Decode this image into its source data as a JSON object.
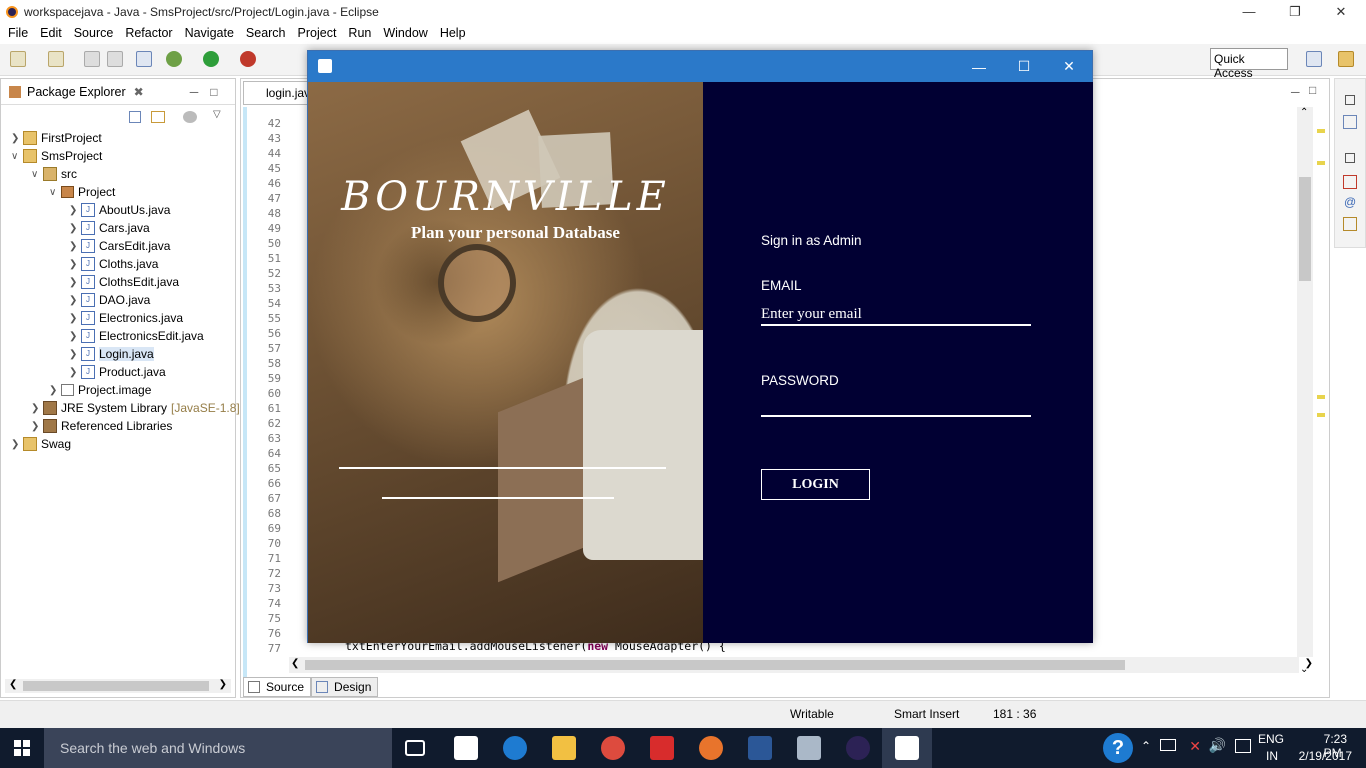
{
  "eclipse": {
    "title": "workspacejava - Java - SmsProject/src/Project/Login.java - Eclipse",
    "menu": [
      "File",
      "Edit",
      "Source",
      "Refactor",
      "Navigate",
      "Search",
      "Project",
      "Run",
      "Window",
      "Help"
    ],
    "quick_access": "Quick Access",
    "package_explorer": {
      "title": "Package Explorer",
      "items": [
        {
          "label": "FirstProject"
        },
        {
          "label": "SmsProject"
        },
        {
          "label": "src"
        },
        {
          "label": "Project"
        },
        {
          "label": "AboutUs.java"
        },
        {
          "label": "Cars.java"
        },
        {
          "label": "CarsEdit.java"
        },
        {
          "label": "Cloths.java"
        },
        {
          "label": "ClothsEdit.java"
        },
        {
          "label": "DAO.java"
        },
        {
          "label": "Electronics.java"
        },
        {
          "label": "ElectronicsEdit.java"
        },
        {
          "label": "Login.java"
        },
        {
          "label": "Product.java"
        },
        {
          "label": "Project.image"
        },
        {
          "label": "JRE System Library"
        },
        {
          "label": "Referenced Libraries"
        },
        {
          "label": "Swag"
        }
      ],
      "jre_suffix": "[JavaSE-1.8]"
    },
    "editor": {
      "tab": "login.java",
      "line_numbers": [
        "42",
        "43",
        "44",
        "45",
        "46",
        "47",
        "48",
        "49",
        "50",
        "51",
        "52",
        "53",
        "54",
        "55",
        "56",
        "57",
        "58",
        "59",
        "60",
        "61",
        "62",
        "63",
        "64",
        "65",
        "66",
        "67",
        "68",
        "69",
        "70",
        "71",
        "72",
        "73",
        "74",
        "75",
        "76",
        "77"
      ],
      "code_line_77_a": "txtEnterYourEmail.addMouseListener(",
      "code_line_77_kw": "new",
      "code_line_77_b": " MouseAdapter() {",
      "bottom_tabs": [
        "Source",
        "Design"
      ]
    },
    "status": {
      "writable": "Writable",
      "insert_mode": "Smart Insert",
      "position": "181 : 36"
    }
  },
  "dialog": {
    "brand": "BOURNVILLE",
    "tagline": "Plan your personal Database",
    "sign_in_label": "Sign in as Admin",
    "email_label": "EMAIL",
    "email_placeholder": "Enter your email",
    "password_label": "PASSWORD",
    "login_button": "LOGIN",
    "colors": {
      "titlebar": "#2b79c9",
      "right_panel": "#010033"
    }
  },
  "taskbar": {
    "search_placeholder": "Search the web and Windows",
    "lang_top": "ENG",
    "lang_bottom": "IN",
    "time": "7:23 PM",
    "date": "2/19/2017"
  }
}
